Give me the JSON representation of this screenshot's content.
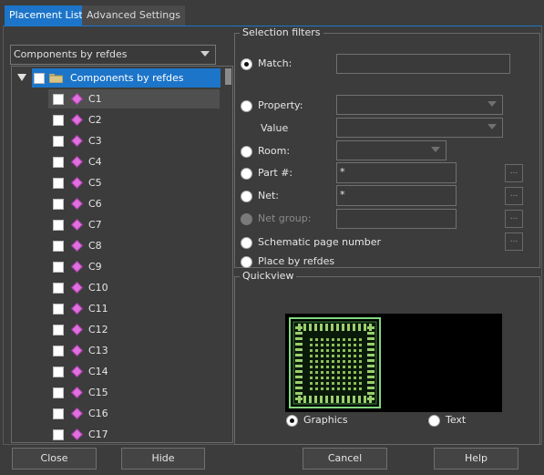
{
  "tabs": {
    "placement_list": "Placement List",
    "advanced_settings": "Advanced Settings"
  },
  "left": {
    "combo_value": "Components by refdes",
    "tree_root": "Components by refdes",
    "items": [
      "C1",
      "C2",
      "C3",
      "C4",
      "C5",
      "C6",
      "C7",
      "C8",
      "C9",
      "C10",
      "C11",
      "C12",
      "C13",
      "C14",
      "C15",
      "C16",
      "C17"
    ]
  },
  "filters": {
    "title": "Selection filters",
    "match": "Match:",
    "property": "Property:",
    "value": "Value",
    "room": "Room:",
    "part": "Part #:",
    "part_value": "*",
    "net": "Net:",
    "net_value": "*",
    "net_group": "Net group:",
    "schematic": "Schematic page number",
    "place_by_refdes": "Place by refdes",
    "dots": "..."
  },
  "quickview": {
    "title": "Quickview",
    "graphics": "Graphics",
    "text": "Text"
  },
  "buttons": {
    "close": "Close",
    "hide": "Hide",
    "cancel": "Cancel",
    "help": "Help"
  }
}
